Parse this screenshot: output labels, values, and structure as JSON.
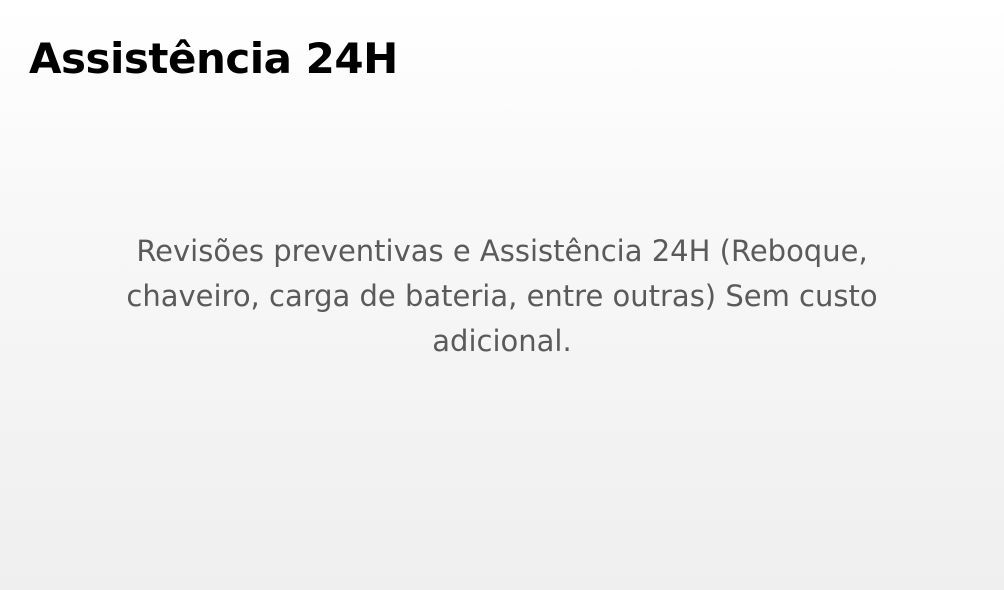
{
  "card": {
    "title": "Assistência 24H",
    "description": "Revisões preventivas e Assistência 24H (Reboque, chaveiro, carga de bateria, entre outras) Sem custo adicional."
  },
  "colors": {
    "title": "#000000",
    "text": "#5a5a5a",
    "background": "#f6f6f6"
  }
}
